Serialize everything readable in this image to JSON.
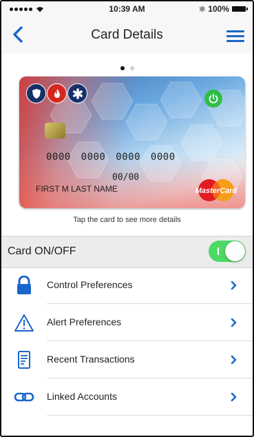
{
  "status_bar": {
    "time": "10:39 AM",
    "battery": "100%"
  },
  "nav": {
    "title": "Card Details",
    "accent_color": "#1a66c9"
  },
  "pager": {
    "count": 2,
    "active_index": 0
  },
  "card": {
    "number": "0000 0000 0000 0000",
    "expiry": "00/00",
    "holder_name": "FIRST M LAST NAME",
    "network_logo": "MasterCard",
    "hint": "Tap the card to see more details"
  },
  "card_toggle": {
    "label": "Card ON/OFF",
    "state": "on",
    "on_color": "#4cd964"
  },
  "menu": {
    "items": [
      {
        "label": "Control Preferences",
        "icon": "lock-icon"
      },
      {
        "label": "Alert Preferences",
        "icon": "warning-icon"
      },
      {
        "label": "Recent Transactions",
        "icon": "receipt-icon"
      },
      {
        "label": "Linked Accounts",
        "icon": "link-icon"
      }
    ]
  }
}
